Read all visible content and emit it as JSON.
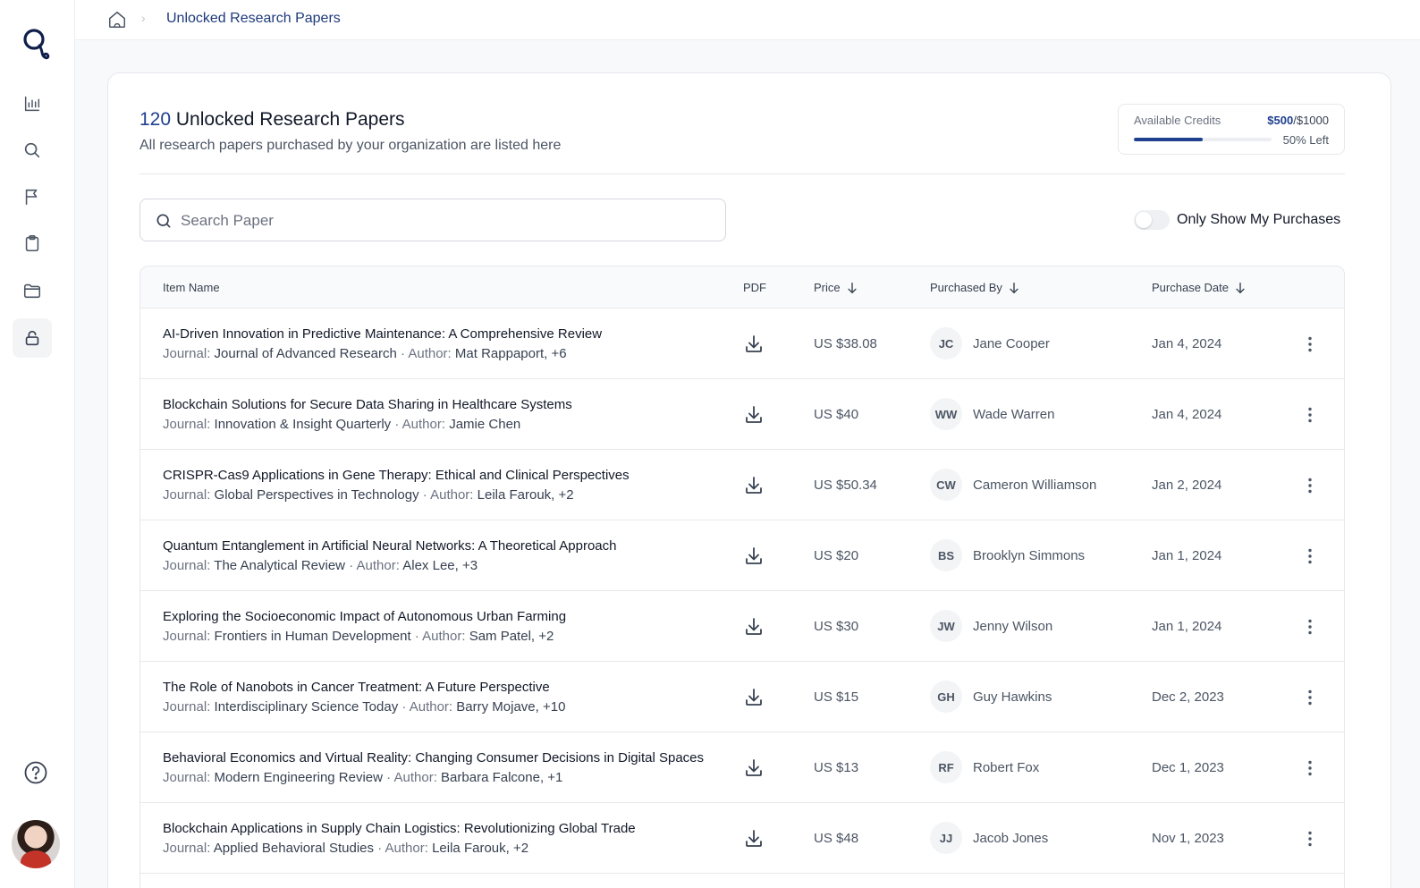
{
  "breadcrumb": {
    "current": "Unlocked Research Papers",
    "separator": "›"
  },
  "header": {
    "count": "120",
    "title": "Unlocked Research Papers",
    "subtitle": "All research papers purchased by your organization are listed here"
  },
  "credits": {
    "label": "Available Credits",
    "used": "$500",
    "separator": "/",
    "total": "$1000",
    "left_text": "50% Left",
    "fill_fraction": 0.5
  },
  "search": {
    "placeholder": "Search Paper",
    "value": ""
  },
  "toggle": {
    "label": "Only Show My Purchases",
    "on": false
  },
  "table": {
    "headers": {
      "item_name": "Item Name",
      "pdf": "PDF",
      "price": "Price",
      "purchased_by": "Purchased By",
      "purchase_date": "Purchase Date"
    },
    "journal_label": "Journal:",
    "author_label": "Author:",
    "meta_sep": "·",
    "rows": [
      {
        "title": "AI-Driven Innovation in Predictive Maintenance: A Comprehensive Review",
        "journal": "Journal of Advanced Research",
        "author": "Mat Rappaport, +6",
        "price": "US $38.08",
        "initials": "JC",
        "buyer": "Jane Cooper",
        "date": "Jan 4, 2024"
      },
      {
        "title": "Blockchain Solutions for Secure Data Sharing in Healthcare Systems",
        "journal": "Innovation & Insight Quarterly",
        "author": "Jamie Chen",
        "price": "US $40",
        "initials": "WW",
        "buyer": "Wade Warren",
        "date": "Jan 4, 2024"
      },
      {
        "title": "CRISPR-Cas9 Applications in Gene Therapy: Ethical and Clinical Perspectives",
        "journal": "Global Perspectives in Technology",
        "author": "Leila Farouk, +2",
        "price": "US $50.34",
        "initials": "CW",
        "buyer": "Cameron Williamson",
        "date": "Jan 2, 2024"
      },
      {
        "title": "Quantum Entanglement in Artificial Neural Networks: A Theoretical Approach",
        "journal": "The Analytical Review",
        "author": "Alex Lee, +3",
        "price": "US $20",
        "initials": "BS",
        "buyer": "Brooklyn Simmons",
        "date": "Jan 1, 2024"
      },
      {
        "title": "Exploring the Socioeconomic Impact of Autonomous Urban Farming",
        "journal": "Frontiers in Human Development",
        "author": "Sam Patel, +2",
        "price": "US $30",
        "initials": "JW",
        "buyer": "Jenny Wilson",
        "date": "Jan 1, 2024"
      },
      {
        "title": "The Role of Nanobots in Cancer Treatment: A Future Perspective",
        "journal": "Interdisciplinary Science Today",
        "author": "Barry Mojave, +10",
        "price": "US $15",
        "initials": "GH",
        "buyer": "Guy Hawkins",
        "date": "Dec 2, 2023"
      },
      {
        "title": "Behavioral Economics and Virtual Reality: Changing Consumer Decisions in Digital Spaces",
        "journal": "Modern Engineering Review",
        "author": "Barbara Falcone, +1",
        "price": "US $13",
        "initials": "RF",
        "buyer": "Robert Fox",
        "date": "Dec 1, 2023"
      },
      {
        "title": "Blockchain Applications in Supply Chain Logistics: Revolutionizing Global Trade",
        "journal": "Applied Behavioral Studies",
        "author": "Leila Farouk, +2",
        "price": "US $48",
        "initials": "JJ",
        "buyer": "Jacob Jones",
        "date": "Nov 1, 2023"
      }
    ]
  },
  "sidebar": {
    "icons": [
      "analytics-icon",
      "search-icon",
      "flag-icon",
      "clipboard-icon",
      "folder-icon",
      "lock-icon"
    ],
    "active": "lock-icon"
  },
  "colors": {
    "accent": "#1f3f8f",
    "text": "#111827",
    "muted": "#6b7280",
    "border": "#e6e8ec"
  }
}
